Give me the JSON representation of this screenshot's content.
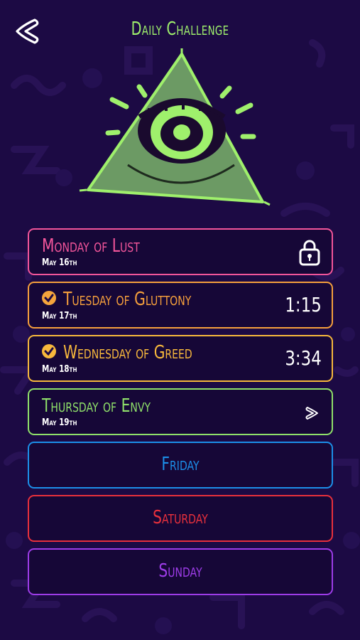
{
  "header": {
    "title": "Daily Challenge"
  },
  "colors": {
    "background": "#1c0a44",
    "title": "#9ff06c",
    "monday": "#f2559a",
    "tuesday": "#f59f3c",
    "wednesday": "#f7b83c",
    "thursday": "#8fe06a",
    "friday": "#1c8fe8",
    "saturday": "#e8303c",
    "sunday": "#9d3ce8"
  },
  "days": [
    {
      "name": "Monday of Lust",
      "date": "May 16th",
      "status": "locked",
      "icon": "lock-icon"
    },
    {
      "name": "Tuesday of Gluttony",
      "date": "May 17th",
      "status": "completed",
      "time": "1:15",
      "icon": "check-icon"
    },
    {
      "name": "Wednesday of Greed",
      "date": "May 18th",
      "status": "completed",
      "time": "3:34",
      "icon": "check-icon"
    },
    {
      "name": "Thursday of Envy",
      "date": "May 19th",
      "status": "available",
      "icon": "chevron-right-icon"
    },
    {
      "name": "Friday",
      "status": "upcoming"
    },
    {
      "name": "Saturday",
      "status": "upcoming"
    },
    {
      "name": "Sunday",
      "status": "upcoming"
    }
  ]
}
